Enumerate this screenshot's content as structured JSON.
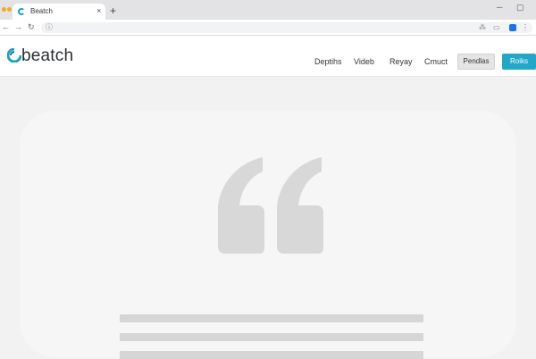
{
  "browser": {
    "tab": {
      "title": "Beatch",
      "close_glyph": "×",
      "favicon": "beatch-favicon-icon"
    },
    "new_tab_glyph": "+",
    "toolbar": {
      "back_glyph": "←",
      "forward_glyph": "→",
      "reload_glyph": "↻",
      "omnibox_icon": "info-icon",
      "omnibox_glyph": "ⓘ",
      "right_icons": [
        "translate-icon",
        "cast-icon",
        "extensions-icon"
      ],
      "right_glyphs": [
        "⁂",
        "▭",
        "▣"
      ]
    }
  },
  "header": {
    "logo_text": "beatch",
    "nav": [
      "Deptihs",
      "Videb",
      "Reyay",
      "Cmuct"
    ],
    "secondary_button": "Pendlas",
    "primary_button": "Roiks"
  },
  "hero": {
    "quote_icon": "quote-mark-icon",
    "placeholder_lines": 3
  },
  "colors": {
    "accent": "#22a7c9",
    "tab_favicon": "#1aa3c8",
    "quote_mark": "#d8d8d8",
    "placeholder_line": "#d6d6d6"
  }
}
